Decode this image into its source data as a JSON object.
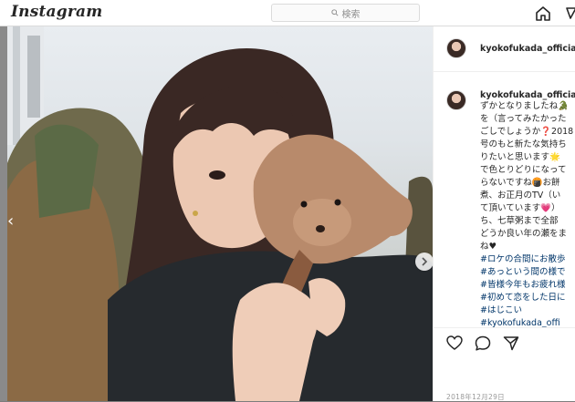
{
  "app": {
    "logo": "Instagram"
  },
  "search": {
    "placeholder": "検索"
  },
  "icons": {
    "search": "search-icon",
    "home": "home-icon",
    "prev": "chevron-left-icon",
    "next": "chevron-right-icon",
    "like": "heart-icon",
    "comment": "comment-icon",
    "share": "send-icon"
  },
  "post": {
    "username": "kyokofukada_official",
    "date": "2018年12月29日",
    "caption": {
      "username": "kyokofukada_official",
      "lines": [
        "ずかとなりましたね🐊",
        "を（言ってみたかった",
        "ごしでしょうか❓2018",
        "号のもと新たな気持ち",
        "りたいと思います🌟",
        "で色とりどりになって",
        "らないですね🍘お餅",
        "煮、お正月のTV（い",
        "て頂いています💗）",
        "ち、七草粥まで全部",
        "どうか良い年の瀬をま",
        "ね♥",
        "#ロケの合間にお散歩",
        "#あっという間の様で",
        "#皆様今年もお疲れ様",
        "#初めて恋をした日に",
        "#はじこい",
        "#kyokofukada_offi"
      ]
    }
  }
}
